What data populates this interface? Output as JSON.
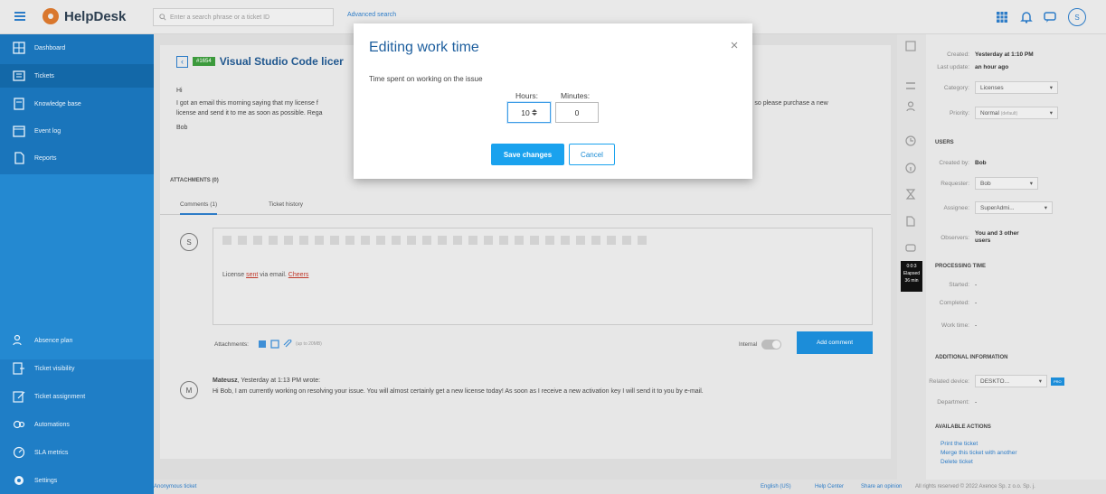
{
  "app": {
    "name": "HelpDesk"
  },
  "search": {
    "placeholder": "Enter a search phrase or a ticket ID",
    "advanced_label": "Advanced search"
  },
  "topbar": {
    "user_initial": "S"
  },
  "sidebar": {
    "items": [
      {
        "label": "Dashboard",
        "icon": "dashboard-icon"
      },
      {
        "label": "Tickets",
        "icon": "tickets-icon",
        "active": true
      },
      {
        "label": "Knowledge base",
        "icon": "knowledge-base-icon"
      },
      {
        "label": "Event log",
        "icon": "event-log-icon"
      },
      {
        "label": "Reports",
        "icon": "reports-icon"
      }
    ],
    "bottom_items": [
      {
        "label": "Absence plan",
        "icon": "absence-plan-icon"
      },
      {
        "label": "Ticket visibility",
        "icon": "ticket-visibility-icon"
      },
      {
        "label": "Ticket assignment",
        "icon": "ticket-assignment-icon"
      },
      {
        "label": "Automations",
        "icon": "automations-icon"
      },
      {
        "label": "SLA metrics",
        "icon": "sla-metrics-icon"
      },
      {
        "label": "Settings",
        "icon": "settings-icon"
      }
    ]
  },
  "ticket": {
    "number": "#1654",
    "title": "Visual Studio Code licer",
    "greeting": "Hi",
    "body_line1": "I got an email this morning saying that my license f",
    "body_line1_end": "s, so please purchase a new",
    "body_line2": "license and send it to me as soon as possible. Rega",
    "signature": "Bob",
    "attachments_label": "ATTACHMENTS (0)"
  },
  "tabs": [
    {
      "label": "Comments (1)"
    },
    {
      "label": "Ticket history"
    }
  ],
  "editor": {
    "avatar_initial": "S",
    "text_prefix": "License ",
    "text_sent": "sent",
    "text_middle": " via email. ",
    "text_cheers": "Cheers",
    "attachments_label": "Attachments:",
    "size_note": "(up to 20MB)",
    "internal_label": "Internal",
    "add_comment_label": "Add comment"
  },
  "comment": {
    "avatar_initial": "M",
    "author": "Mateusz",
    "meta": ", Yesterday at 1:13 PM wrote:",
    "text": "Hi Bob, I am currently working on resolving your issue. You will almost certainly get a new license today! As soon as I receive a new activation key I will send it to you by e-mail."
  },
  "footer": {
    "left": "Anonymous ticket",
    "language": "English (US)",
    "help_center": "Help Center",
    "share_opinion": "Share an opinion",
    "rights": "All rights reserved © 2022 Axence Sp. z o.o. Sp. j."
  },
  "timer": {
    "line1": "0:0:3",
    "line2": "Elapsed",
    "line3": "36 min"
  },
  "right_panel": {
    "created_label": "Created:",
    "created_value": "Yesterday at 1:10 PM",
    "updated_label": "Last update:",
    "updated_value": "an hour ago",
    "category_label": "Category:",
    "category_value": "Licenses",
    "priority_label": "Priority:",
    "priority_value": "Normal",
    "priority_note": "(default)",
    "users_heading": "USERS",
    "created_by_label": "Created by:",
    "created_by_value": "Bob",
    "requester_label": "Requester:",
    "requester_value": "Bob",
    "assignee_label": "Assignee:",
    "assignee_value": "SuperAdmi...",
    "observers_label": "Observers:",
    "observers_value": "You and 3 other users",
    "processing_heading": "PROCESSING TIME",
    "started_label": "Started:",
    "started_value": "-",
    "completed_label": "Completed:",
    "completed_value": "-",
    "worktime_label": "Work time:",
    "worktime_value": "-",
    "additional_heading": "ADDITIONAL INFORMATION",
    "related_label": "Related device:",
    "related_value": "DESKTO...",
    "related_badge": "PRO",
    "department_label": "Department:",
    "department_value": "-",
    "actions_heading": "AVAILABLE ACTIONS",
    "actions": [
      "Print the ticket",
      "Merge this ticket with another",
      "Delete ticket"
    ]
  },
  "modal": {
    "title": "Editing work time",
    "description": "Time spent on working on the issue",
    "hours_label": "Hours:",
    "hours_value": "10",
    "minutes_label": "Minutes:",
    "minutes_value": "0",
    "save_label": "Save changes",
    "cancel_label": "Cancel"
  },
  "colors": {
    "accent": "#1aa2ee",
    "sidebar": "#1f7ec6",
    "ticket_badge": "#3c9a3c",
    "title_blue": "#1e5f9e"
  }
}
